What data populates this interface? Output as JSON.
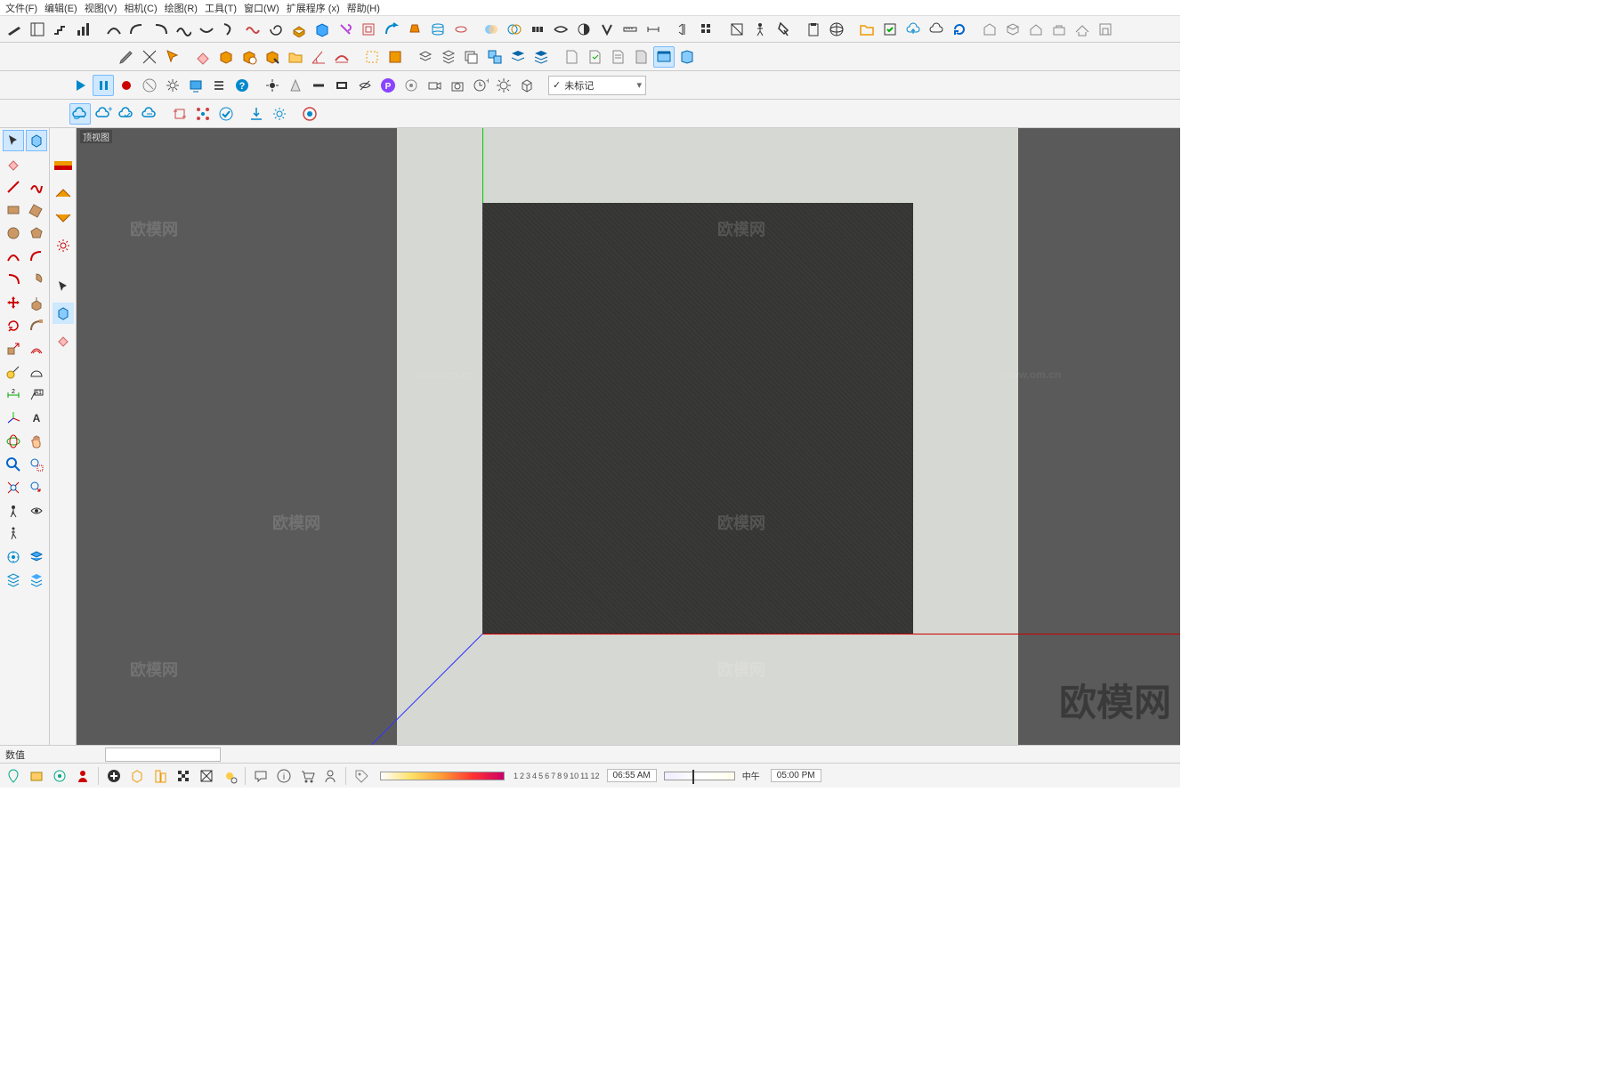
{
  "menu": {
    "items": [
      "文件(F)",
      "编辑(E)",
      "视图(V)",
      "相机(C)",
      "绘图(R)",
      "工具(T)",
      "窗口(W)",
      "扩展程序 (x)",
      "帮助(H)"
    ]
  },
  "tag_dropdown": {
    "value": "未标记"
  },
  "viewport": {
    "label": "顶视图"
  },
  "watermarks": {
    "text": "欧模网",
    "url": "www.om.cn",
    "big": "欧模网"
  },
  "statusbar": {
    "label": "数值",
    "value": ""
  },
  "bottombar": {
    "scale_labels": [
      "1",
      "2",
      "3",
      "4",
      "5",
      "6",
      "7",
      "8",
      "9",
      "10",
      "11",
      "12"
    ],
    "time1": "06:55 AM",
    "time_mid": "中午",
    "time2": "05:00 PM"
  }
}
